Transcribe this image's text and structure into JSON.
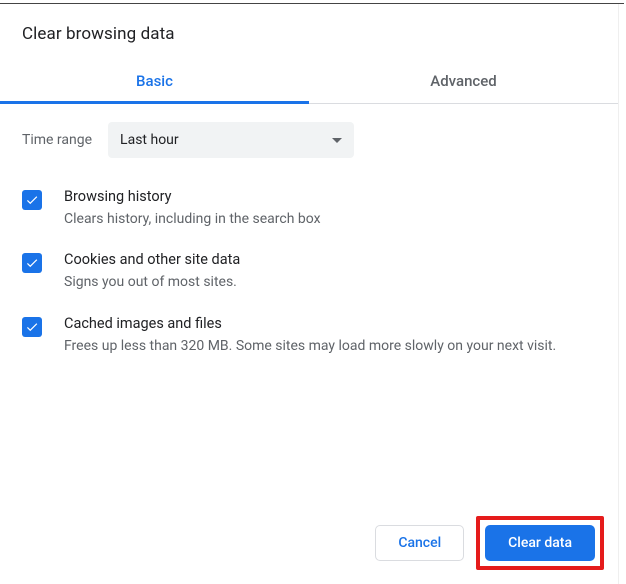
{
  "title": "Clear browsing data",
  "tabs": {
    "basic": "Basic",
    "advanced": "Advanced"
  },
  "time_range": {
    "label": "Time range",
    "selected": "Last hour"
  },
  "options": [
    {
      "title": "Browsing history",
      "desc": "Clears history, including in the search box"
    },
    {
      "title": "Cookies and other site data",
      "desc": "Signs you out of most sites."
    },
    {
      "title": "Cached images and files",
      "desc": "Frees up less than 320 MB. Some sites may load more slowly on your next visit."
    }
  ],
  "buttons": {
    "cancel": "Cancel",
    "clear": "Clear data"
  }
}
